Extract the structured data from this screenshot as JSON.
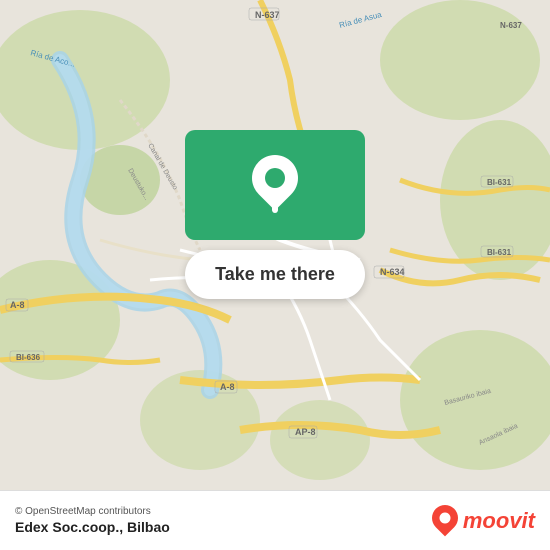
{
  "map": {
    "attribution": "© OpenStreetMap contributors",
    "location_label": "Edex Soc.coop., Bilbao",
    "cta_button_label": "Take me there"
  },
  "branding": {
    "moovit_name": "moovit"
  },
  "colors": {
    "green": "#2eaa6e",
    "red": "#f44336",
    "white": "#ffffff"
  }
}
